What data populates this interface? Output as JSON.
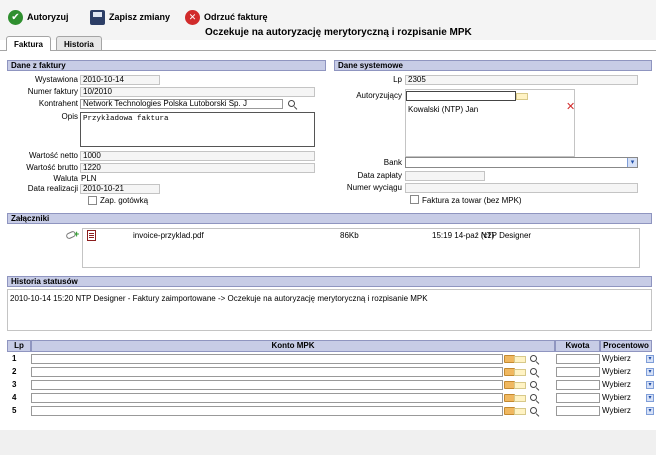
{
  "toolbar": {
    "authorize_label": "Autoryzuj",
    "save_label": "Zapisz zmiany",
    "reject_label": "Odrzuć fakturę"
  },
  "page_title": "Oczekuje na autoryzację merytoryczną i rozpisanie MPK",
  "tabs": [
    {
      "label": "Faktura",
      "active": true
    },
    {
      "label": "Historia",
      "active": false
    }
  ],
  "invoice": {
    "section_title": "Dane z faktury",
    "issued_label": "Wystawiona",
    "issued_value": "2010-10-14",
    "number_label": "Numer faktury",
    "number_value": "10/2010",
    "contractor_label": "Kontrahent",
    "contractor_value": "Network Technologies Polska Lutoborski Sp. J",
    "description_label": "Opis",
    "description_value": "Przykładowa faktura",
    "net_label": "Wartość netto",
    "net_value": "1000",
    "gross_label": "Wartość brutto",
    "gross_value": "1220",
    "currency_label": "Waluta",
    "currency_value": "PLN",
    "realization_label": "Data realizacji",
    "realization_value": "2010-10-21",
    "cash_label": "Zap. gotówką"
  },
  "system": {
    "section_title": "Dane systemowe",
    "lp_label": "Lp",
    "lp_value": "2305",
    "authorizer_label": "Autoryzujący",
    "authorizer_value": "Kowalski (NTP) Jan",
    "bank_label": "Bank",
    "payment_date_label": "Data zapłaty",
    "statement_label": "Numer wyciągu",
    "goods_label": "Faktura za towar (bez MPK)"
  },
  "attachments": {
    "section_title": "Załączniki",
    "items": [
      {
        "name": "invoice-przyklad.pdf",
        "size": "86Kb",
        "date": "15:19 14-paź (cz)",
        "author": "NTP Designer"
      }
    ]
  },
  "status_history": {
    "section_title": "Historia statusów",
    "entries": [
      "2010-10-14 15:20  NTP Designer - Faktury zaimportowane -> Oczekuje na autoryzację merytoryczną i rozpisanie MPK"
    ]
  },
  "mpk": {
    "col_lp": "Lp",
    "col_account": "Konto MPK",
    "col_amount": "Kwota",
    "col_percent": "Procentowo",
    "rows": [
      {
        "lp": "1",
        "percent": "Wybierz"
      },
      {
        "lp": "2",
        "percent": "Wybierz"
      },
      {
        "lp": "3",
        "percent": "Wybierz"
      },
      {
        "lp": "4",
        "percent": "Wybierz"
      },
      {
        "lp": "5",
        "percent": "Wybierz"
      }
    ]
  },
  "colors": {
    "section_header_bg": "#c7cce6",
    "section_header_border": "#8f95c0",
    "accept_icon": "#2f8f2f",
    "reject_icon": "#d12b2b"
  },
  "icons": [
    "accept-icon",
    "save-icon",
    "reject-icon",
    "search-icon",
    "folder-icon",
    "remove-icon",
    "pdf-icon",
    "add-attachment-icon",
    "chevron-down-icon"
  ]
}
